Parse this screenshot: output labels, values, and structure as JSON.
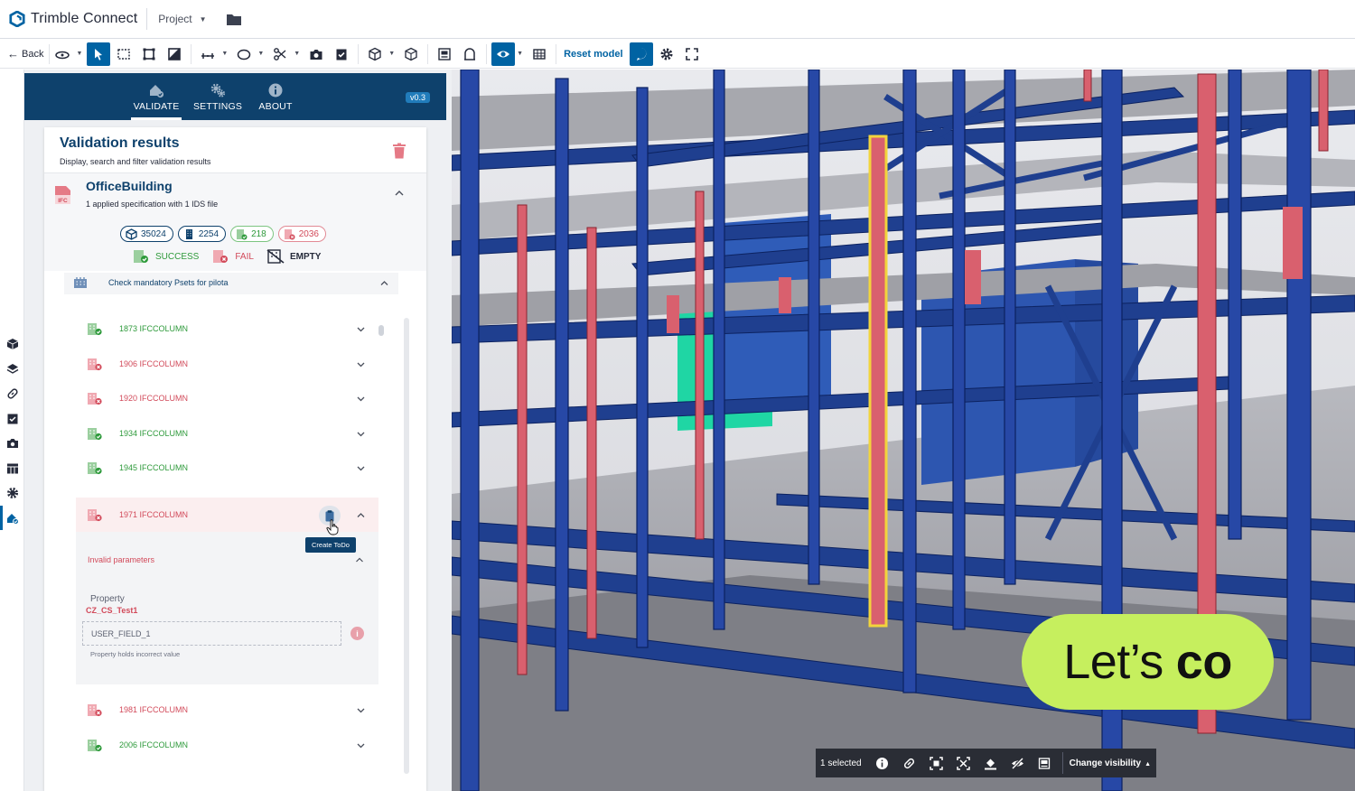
{
  "app": {
    "brand_name": "Trimble Connect",
    "project_label": "Project"
  },
  "toolbar": {
    "back_label": "Back",
    "reset_model_label": "Reset model"
  },
  "panel": {
    "tabs": [
      {
        "label": "VALIDATE"
      },
      {
        "label": "SETTINGS"
      },
      {
        "label": "ABOUT"
      }
    ],
    "version": "v0.3",
    "card": {
      "title": "Validation results",
      "subtitle": "Display, search and filter validation results"
    },
    "model": {
      "icon_text": "IFC",
      "name": "OfficeBuilding",
      "subtitle": "1 applied specification with 1 IDS file",
      "counts": {
        "objects": "35024",
        "checked": "2254",
        "success": "218",
        "fail": "2036"
      },
      "legend": {
        "success": "SUCCESS",
        "fail": "FAIL",
        "empty": "EMPTY"
      }
    },
    "spec": {
      "title": "Check mandatory Psets for pilota",
      "items": [
        {
          "label": "1873 IFCCOLUMN",
          "status": "success"
        },
        {
          "label": "1906 IFCCOLUMN",
          "status": "fail"
        },
        {
          "label": "1920 IFCCOLUMN",
          "status": "fail"
        },
        {
          "label": "1934 IFCCOLUMN",
          "status": "success"
        },
        {
          "label": "1945 IFCCOLUMN",
          "status": "success"
        }
      ],
      "expanded": {
        "label": "1971 IFCCOLUMN",
        "status": "fail",
        "tooltip": "Create ToDo",
        "invalid_heading": "Invalid parameters",
        "property_label": "Property",
        "property_name": "CZ_CS_Test1",
        "field_value": "USER_FIELD_1",
        "help": "Property holds incorrect value"
      },
      "items_after": [
        {
          "label": "1981 IFCCOLUMN",
          "status": "fail"
        },
        {
          "label": "2006 IFCCOLUMN",
          "status": "success"
        }
      ]
    }
  },
  "viewport": {
    "overlay_text_1": "Let’s",
    "overlay_text_2": "co",
    "selection": {
      "count_label": "1 selected",
      "change_visibility_label": "Change visibility"
    }
  },
  "colors": {
    "brand_blue": "#0063a3",
    "panel_header": "#0e416c",
    "success": "#2e9a3b",
    "fail": "#d24a5a",
    "steel": "#1f3f8f",
    "failed_column": "#d9606e",
    "highlight": "#c6ef5e"
  }
}
